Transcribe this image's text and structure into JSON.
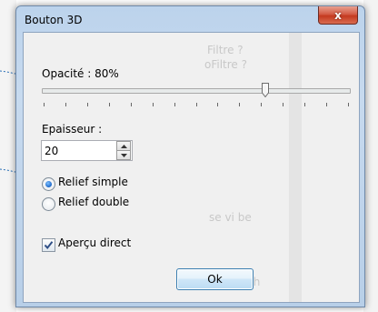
{
  "window": {
    "title": "Bouton 3D",
    "close_glyph": "x"
  },
  "background_text": {
    "line1": "Filtre ?",
    "line2": "oFiltre ?",
    "line3": "se vi be",
    "line4": "ias h"
  },
  "opacity": {
    "label": "Opacité : 80%",
    "value_percent": 80,
    "tick_count": 15
  },
  "thickness": {
    "label": "Epaisseur :",
    "value": "20"
  },
  "relief": {
    "options": [
      {
        "label": "Relief simple",
        "checked": true
      },
      {
        "label": "Relief double",
        "checked": false
      }
    ]
  },
  "preview": {
    "label": "Aperçu direct",
    "checked": true
  },
  "ok_button": {
    "label": "Ok"
  },
  "colors": {
    "title_bar": "#c7daef",
    "close_button": "#c4391f",
    "client_bg": "#f0f0f0",
    "callout_arrow": "#2a6fb6"
  }
}
